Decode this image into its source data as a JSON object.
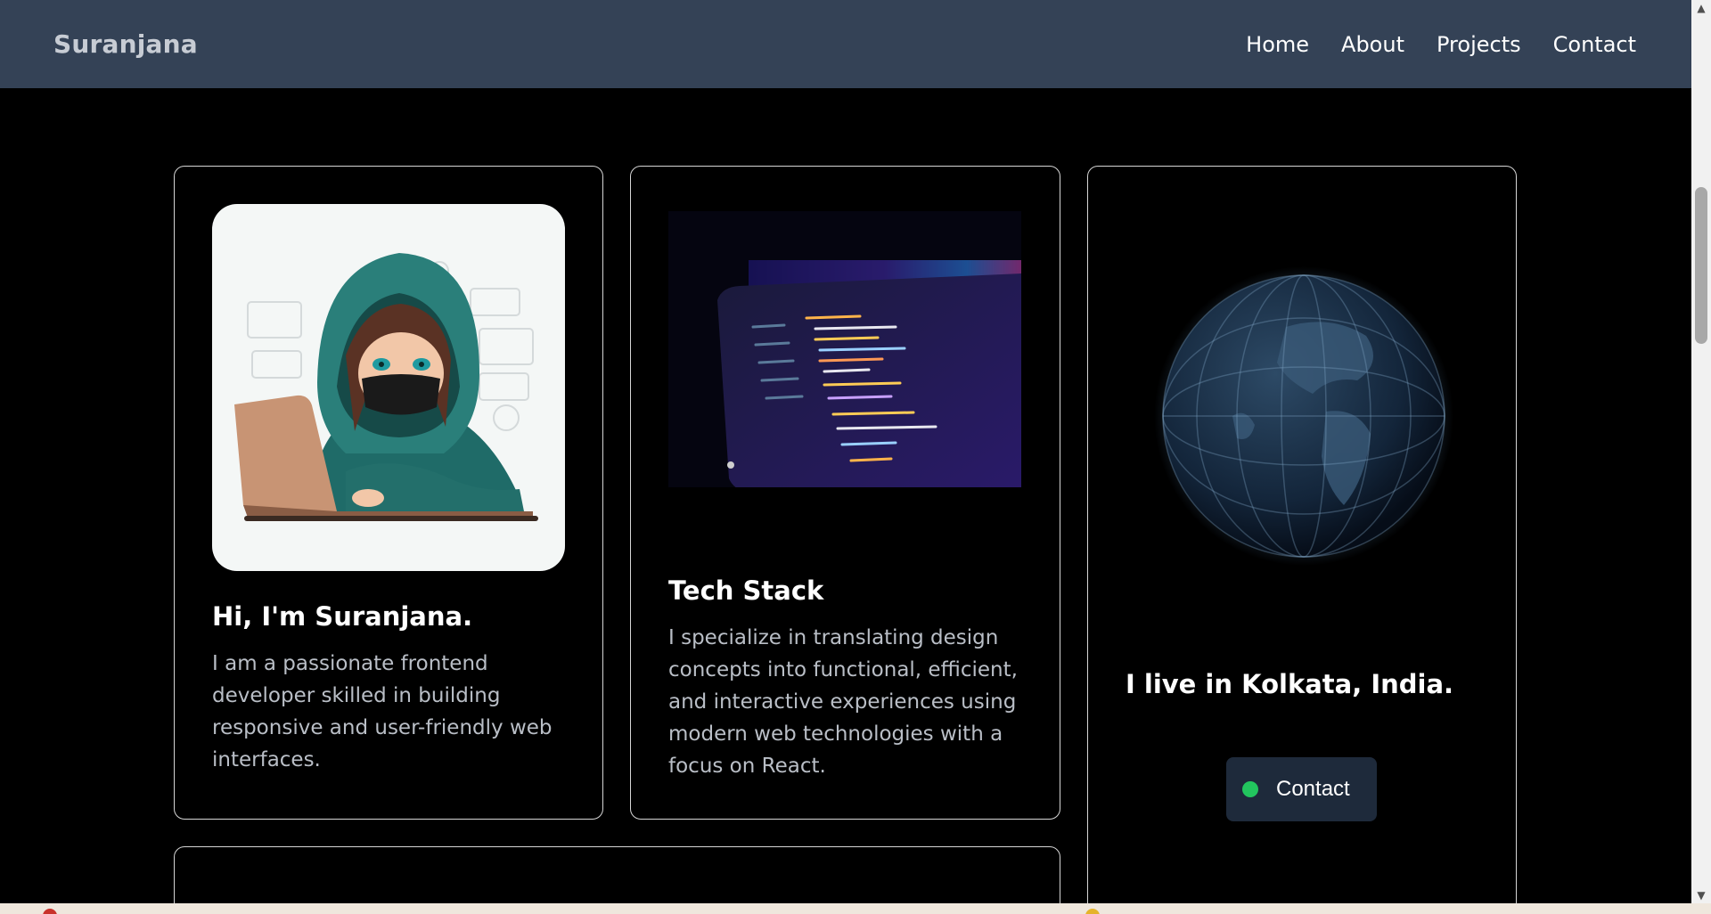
{
  "navbar": {
    "brand": "Suranjana",
    "links": [
      {
        "label": "Home"
      },
      {
        "label": "About"
      },
      {
        "label": "Projects"
      },
      {
        "label": "Contact"
      }
    ]
  },
  "cards": {
    "intro": {
      "title": "Hi, I'm Suranjana.",
      "text": "I am a passionate frontend developer skilled in building responsive and user-friendly web interfaces.",
      "image_icon": "hooded-developer-illustration"
    },
    "tech": {
      "title": "Tech Stack",
      "text": "I specialize in translating design concepts into functional, efficient, and interactive experiences using modern web technologies with a focus on React.",
      "image_icon": "laptop-code-screen"
    },
    "location": {
      "title": "I live in Kolkata, India.",
      "image_icon": "globe-icon",
      "contact_button": "Contact",
      "status_color": "#22c55e"
    }
  },
  "colors": {
    "navbar_bg": "#344256",
    "page_bg": "#000000",
    "button_bg": "#1e2a3b"
  }
}
